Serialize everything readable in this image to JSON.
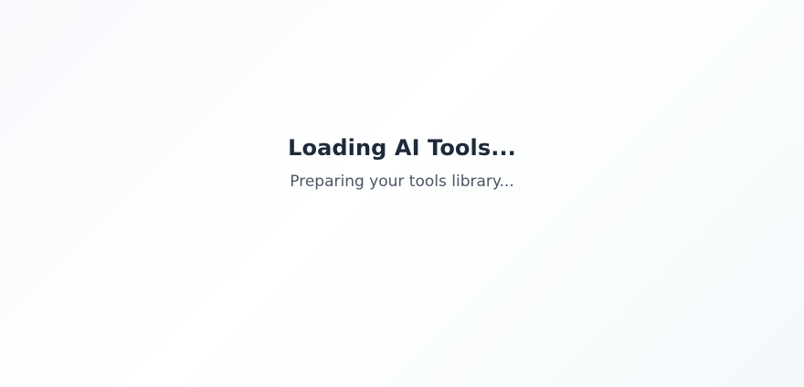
{
  "loading": {
    "title": "Loading AI Tools...",
    "subtitle": "Preparing your tools library..."
  },
  "colors": {
    "title": "#1e2a3b",
    "subtitle": "#4a5565",
    "background": "#f7f9fc"
  }
}
